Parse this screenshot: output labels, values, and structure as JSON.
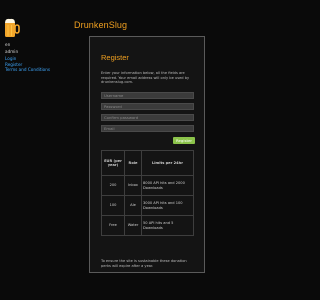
{
  "site": {
    "title": "DrunkenSlug",
    "logo_icon": "beer-mug-icon"
  },
  "sidebar": {
    "language": "en",
    "user": "admin",
    "links": [
      {
        "label": "Login"
      },
      {
        "label": "Register"
      },
      {
        "label": "Terms and Conditions"
      }
    ]
  },
  "register": {
    "heading": "Register",
    "intro": "Enter your information below, all the fields are required. Your email address will only be used by drunkenslug.com.",
    "fields": {
      "username_placeholder": "Username",
      "password_placeholder": "Password",
      "confirm_placeholder": "Confirm password",
      "email_placeholder": "Email"
    },
    "button_label": "Register",
    "table": {
      "headers": [
        "EUR (per year)",
        "Role",
        "Limits per 24hr"
      ],
      "rows": [
        [
          "200",
          "Inbox",
          "8000 API hits and 2000 Downloads"
        ],
        [
          "100",
          "Ale",
          "3000 API hits and 100 Downloads"
        ],
        [
          "Free",
          "Water",
          "50 API hits and 5 Downloads"
        ]
      ]
    },
    "footer": "To ensure the site is sustainable these donation perks will expire after a year."
  },
  "colors": {
    "accent": "#f0a020",
    "link": "#3fa9ff",
    "button": "#8bc34a"
  }
}
